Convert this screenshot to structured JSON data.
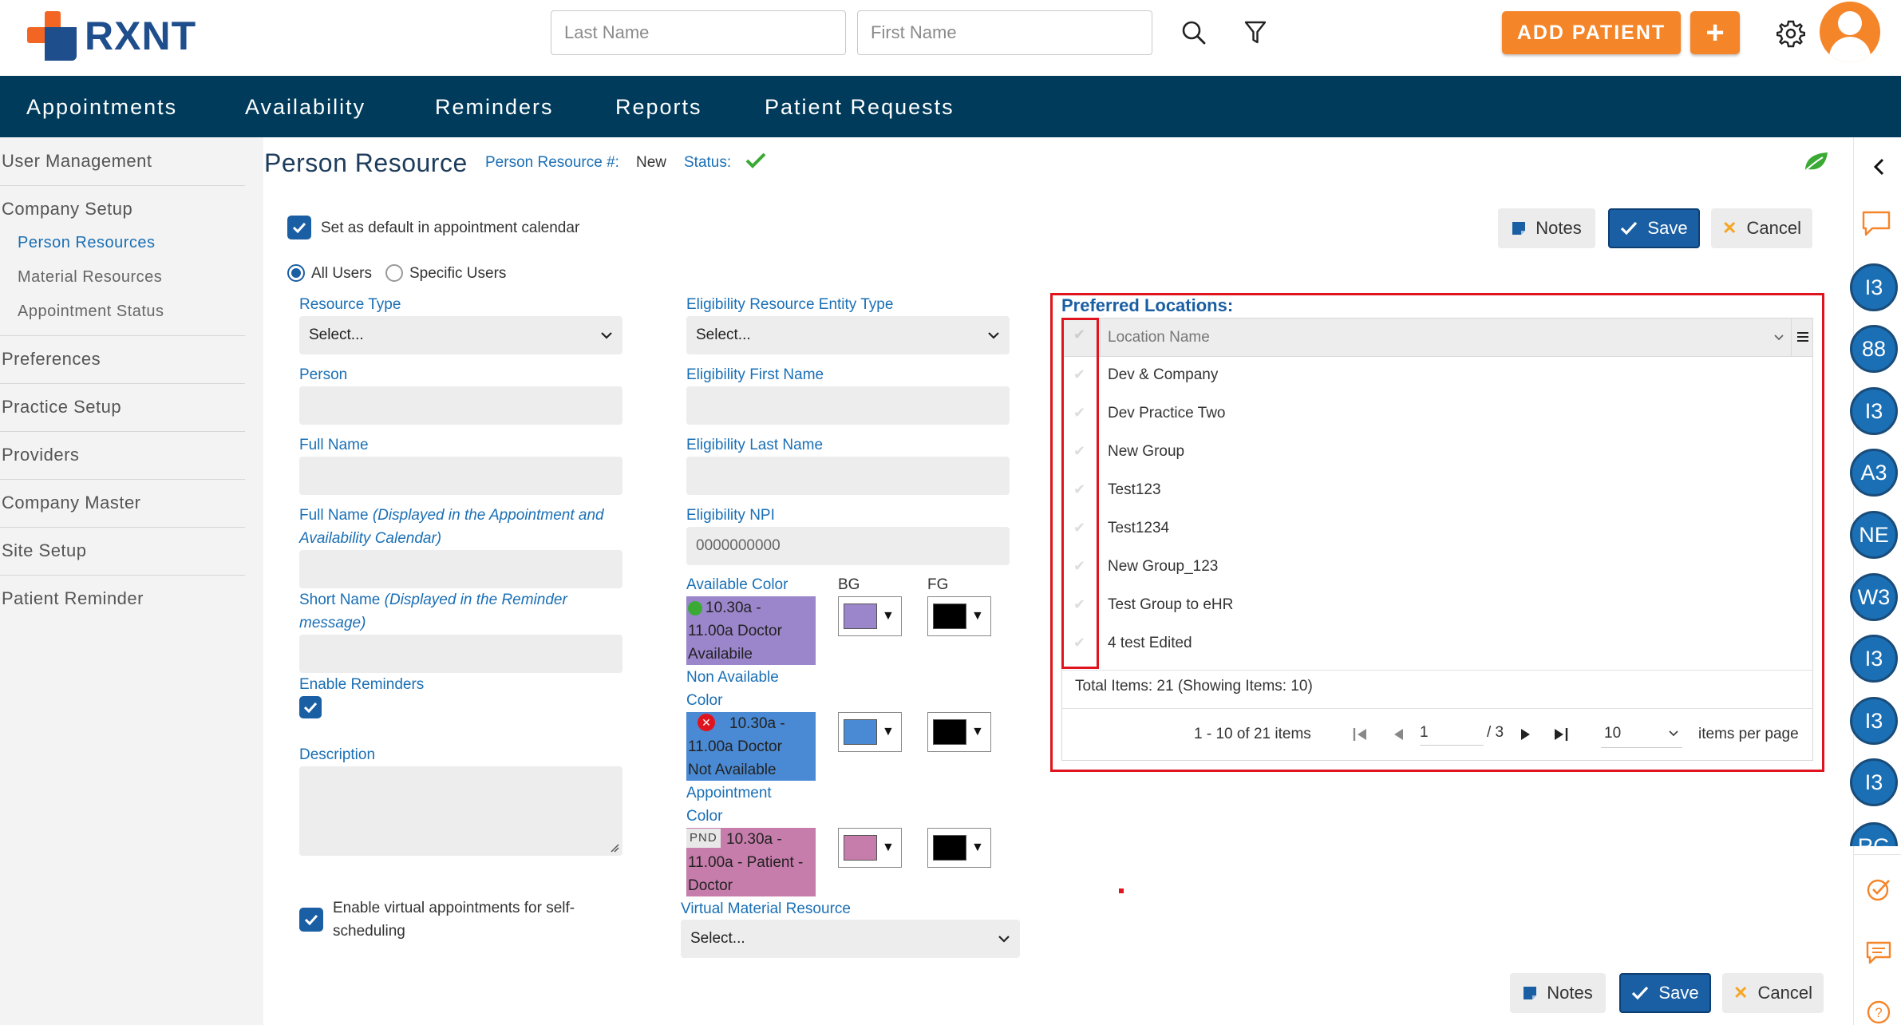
{
  "app": {
    "brand": "RXNT",
    "search": {
      "last_name_placeholder": "Last Name",
      "first_name_placeholder": "First Name"
    },
    "add_patient_label": "ADD PATIENT",
    "plus_label": "+"
  },
  "nav": {
    "items": [
      "Appointments",
      "Availability",
      "Reminders",
      "Reports",
      "Patient Requests"
    ]
  },
  "sidebar": {
    "items": [
      {
        "label": "User Management"
      },
      {
        "label": "Company Setup"
      },
      {
        "label": "Person Resources",
        "sub": true
      },
      {
        "label": "Material Resources",
        "sub": true
      },
      {
        "label": "Appointment Status",
        "sub": true
      },
      {
        "label": "Preferences"
      },
      {
        "label": "Practice Setup"
      },
      {
        "label": "Providers"
      },
      {
        "label": "Company Master"
      },
      {
        "label": "Site Setup"
      },
      {
        "label": "Patient Reminder"
      }
    ]
  },
  "right_strip": {
    "avatars": [
      "I3",
      "88",
      "I3",
      "A3",
      "NE",
      "W3",
      "I3",
      "I3",
      "I3",
      "RG"
    ]
  },
  "page": {
    "title": "Person Resource",
    "resource_number_label": "Person Resource #:",
    "resource_number_value": "New",
    "status_label": "Status:"
  },
  "actions": {
    "notes": "Notes",
    "save": "Save",
    "cancel": "Cancel"
  },
  "form": {
    "default_calendar_label": "Set as default in appointment calendar",
    "all_users_label": "All Users",
    "specific_users_label": "Specific Users",
    "resource_type_label": "Resource Type",
    "resource_type_value": "Select...",
    "person_label": "Person",
    "full_name_label": "Full Name",
    "full_name_display_label_a": "Full Name",
    "full_name_display_label_b": "(Displayed in the Appointment and",
    "full_name_display_label_c": "Availability Calendar)",
    "short_name_label_a": "Short Name",
    "short_name_label_b": "(Displayed in the Reminder",
    "short_name_label_c": "message)",
    "enable_reminders_label": "Enable Reminders",
    "description_label": "Description",
    "virtual_label_a": "Enable virtual appointments for self-",
    "virtual_label_b": "scheduling",
    "elig_entity_type_label": "Eligibility Resource Entity Type",
    "elig_entity_type_value": "Select...",
    "elig_first_name_label": "Eligibility First Name",
    "elig_last_name_label": "Eligibility Last Name",
    "elig_npi_label": "Eligibility NPI",
    "elig_npi_value": "0000000000",
    "bg_label": "BG",
    "fg_label": "FG",
    "available_color_label": "Available Color",
    "available_sample": [
      "10.30a -",
      "11.00a Doctor",
      "Availabile"
    ],
    "non_available_label_a": "Non Available",
    "non_available_label_b": "Color",
    "non_available_sample": [
      "10.30a -",
      "11.00a Doctor",
      "Not Available"
    ],
    "appointment_color_label_a": "Appointment",
    "appointment_color_label_b": "Color",
    "appointment_sample_badge": "PND",
    "appointment_sample": [
      "10.30a -",
      "11.00a - Patient -",
      "Doctor"
    ],
    "virtual_material_label": "Virtual Material Resource",
    "virtual_material_value": "Select..."
  },
  "colors": {
    "available_bg": "#9b86cc",
    "available_fg": "#000000",
    "non_available_bg": "#4a8ad4",
    "non_available_fg": "#000000",
    "appointment_bg": "#c77dab",
    "appointment_fg": "#000000",
    "brand_orange": "#f58529",
    "nav_bg": "#003b5c"
  },
  "preferred_locations": {
    "title": "Preferred Locations:",
    "column_header": "Location Name",
    "rows": [
      "Dev & Company",
      "Dev Practice Two",
      "New Group",
      "Test123",
      "Test1234",
      "New Group_123",
      "Test Group to eHR",
      "4 test Edited"
    ],
    "total_text": "Total Items: 21 (Showing Items: 10)",
    "range_text": "1 - 10 of 21 items",
    "page_value": "1",
    "page_total": "/ 3",
    "per_page_value": "10",
    "per_page_label": "items per page"
  }
}
